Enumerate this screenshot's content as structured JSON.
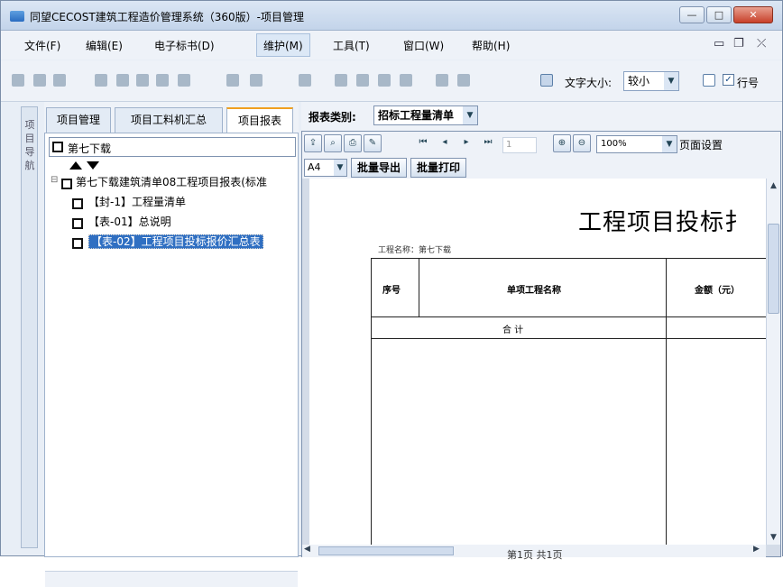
{
  "window": {
    "title": "同望CECOST建筑工程造价管理系统（360版）-项目管理",
    "controls": {
      "minimize": "—",
      "maximize": "□",
      "close": "✕"
    }
  },
  "menubar": {
    "items": [
      "文件(F)",
      "编辑(E)",
      "电子标书(D)",
      "维护(M)",
      "工具(T)",
      "窗口(W)",
      "帮助(H)"
    ]
  },
  "toolbar": {
    "font_size_label": "文字大小:",
    "font_size_value": "较小",
    "line_no_checked": true,
    "line_no_label": "行号"
  },
  "nav_tab": {
    "label": "项目导航"
  },
  "left_pane": {
    "tabs": [
      "项目管理",
      "项目工料机汇总",
      "项目报表"
    ],
    "active_tab": "项目报表",
    "search_value": "第七下载",
    "tree": {
      "root": "第七下载建筑清单08工程项目报表(标准",
      "children": [
        "【封-1】工程量清单",
        "【表-01】总说明",
        "【表-02】工程项目投标报价汇总表"
      ],
      "selected_index": 2
    }
  },
  "right_pane": {
    "report_type_label": "报表类别:",
    "report_type_value": "招标工程量清单",
    "viewer": {
      "page_input": "1",
      "zoom_value": "100%",
      "page_setup_label": "页面设置",
      "paper_value": "A4",
      "batch_export_label": "批量导出",
      "batch_print_label": "批量打印"
    },
    "document": {
      "title": "工程项目投标扌",
      "project_name_label": "工程名称：第七下载",
      "col_seq": "序号",
      "col_name": "单项工程名称",
      "col_amount": "金额（元）",
      "total_label": "合  计"
    },
    "page_status": "第1页 共1页"
  },
  "colors": {
    "selection": "#2f6fc2",
    "active_tab_accent": "#f0a020",
    "window_bg": "#e8eef6"
  }
}
